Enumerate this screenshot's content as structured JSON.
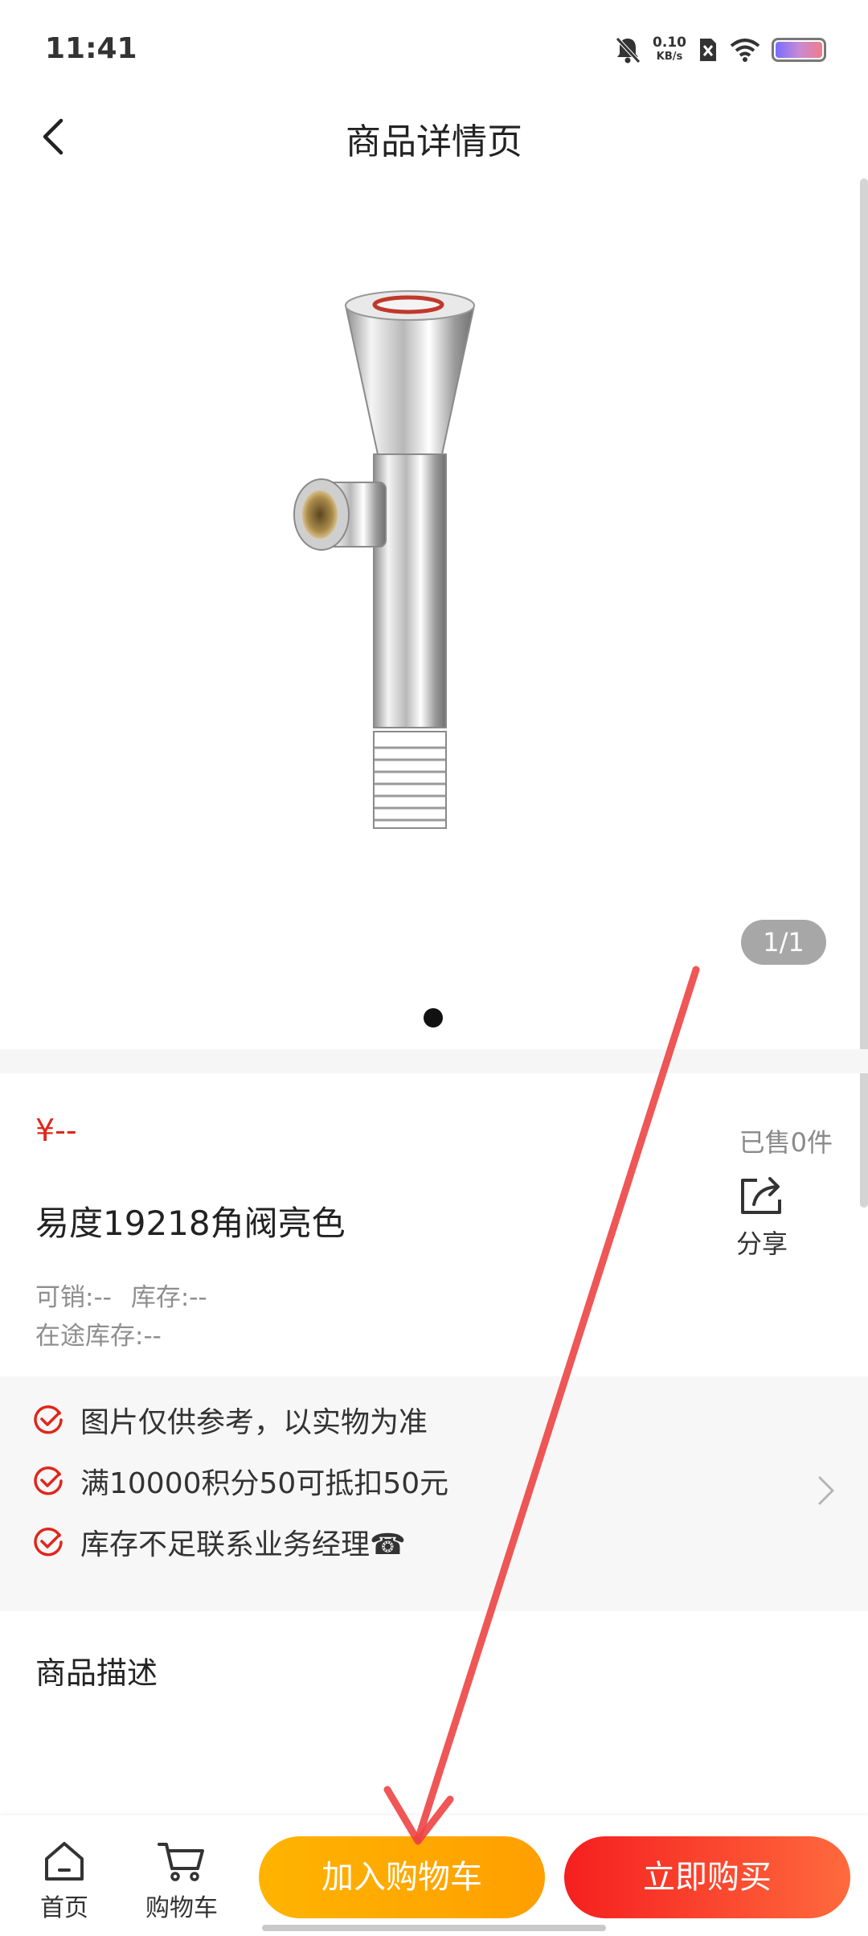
{
  "status": {
    "time": "11:41",
    "net_speed_value": "0.10",
    "net_speed_unit": "KB/s"
  },
  "header": {
    "title": "商品详情页"
  },
  "gallery": {
    "counter": "1/1"
  },
  "product": {
    "price": "¥--",
    "sold": "已售0件",
    "share_label": "分享",
    "name": "易度19218角阀亮色",
    "sellable": "可销:--",
    "stock": "库存:--",
    "in_transit": "在途库存:--"
  },
  "notices": [
    "图片仅供参考，以实物为准",
    "满10000积分50可抵扣50元",
    "库存不足联系业务经理☎"
  ],
  "description": {
    "title": "商品描述"
  },
  "bottom_bar": {
    "home_label": "首页",
    "cart_label": "购物车",
    "add_to_cart": "加入购物车",
    "buy_now": "立即购买"
  },
  "colors": {
    "price_red": "#e1251b",
    "cart_orange": "#ffb300",
    "buy_red": "#f51f1f",
    "annotation_arrow": "#ee4444"
  }
}
